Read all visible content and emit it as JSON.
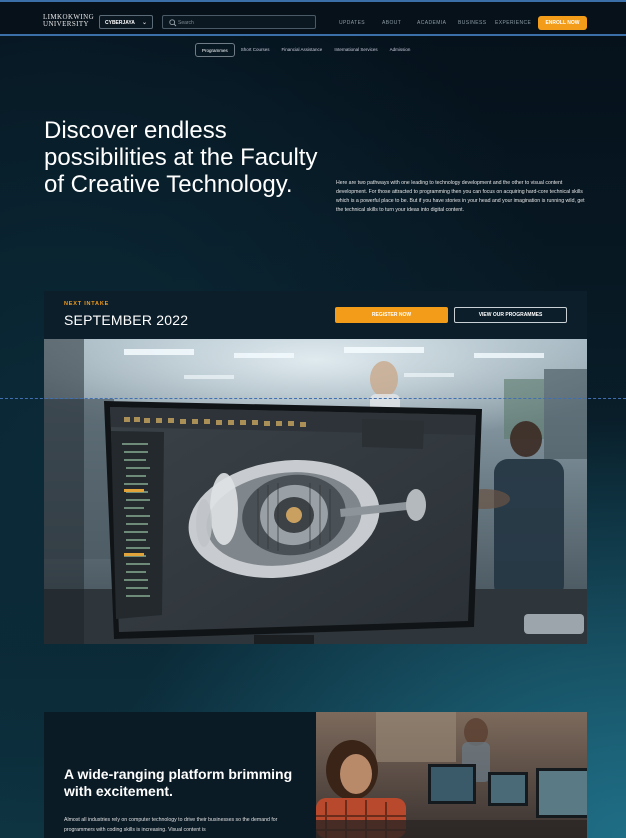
{
  "header": {
    "logo_line1": "LIMKOKWING",
    "logo_line2": "UNIVERSITY",
    "campus": "CYBERJAYA",
    "search_placeholder": "Search",
    "nav": [
      "UPDATES",
      "ABOUT",
      "ACADEMIA",
      "BUSINESS",
      "EXPERIENCE"
    ],
    "enroll": "ENROLL NOW"
  },
  "subnav": {
    "tabs": [
      "Programmes",
      "Short Courses",
      "Financial Assistance",
      "International Services",
      "Admission"
    ],
    "active_index": 0
  },
  "hero": {
    "title": "Discover endless possibilities at the Faculty of Creative Technology.",
    "description": "Here are two pathways with one leading to technology development and the other to visual content development. For those attracted to programming then you can focus on acquiring hard-core technical skills which is a powerful place to be. But if you have stories in your head and your imagination is running wild, get the technical skills to turn your ideas into digital content."
  },
  "intake": {
    "label": "NEXT INTAKE",
    "date": "SEPTEMBER 2022",
    "register": "REGISTER NOW",
    "view": "VIEW OUR PROGRAMMES"
  },
  "platform": {
    "title": "A wide-ranging platform brimming with excitement.",
    "text": "Almost all industries rely on computer technology to drive their businesses so the demand for programmers with coding skills is increasing. Visual content is"
  },
  "colors": {
    "accent": "#f39c19",
    "topbar_rule": "#3b6fa8",
    "background": "#081a25"
  }
}
